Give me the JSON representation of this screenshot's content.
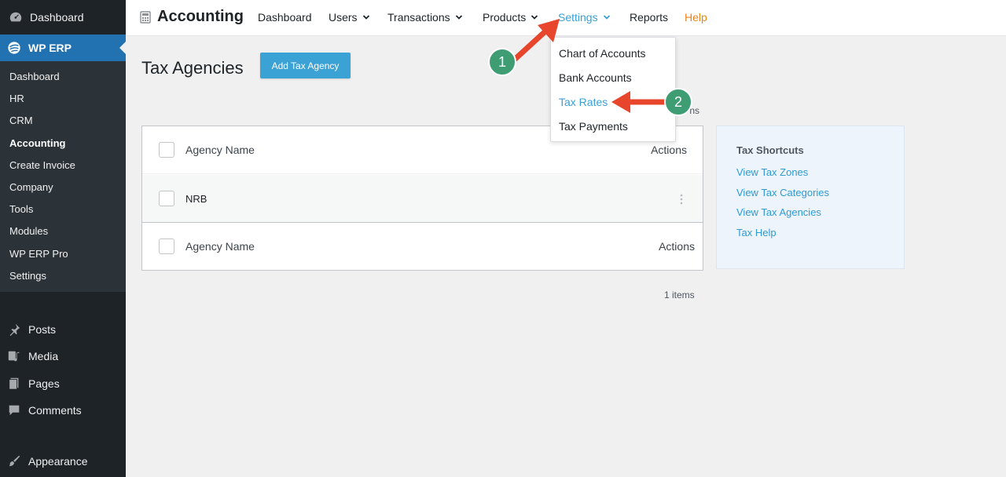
{
  "sidebar": {
    "top_item": "Dashboard",
    "erp_item": "WP ERP",
    "submenu": [
      "Dashboard",
      "HR",
      "CRM",
      "Accounting",
      "Create Invoice",
      "Company",
      "Tools",
      "Modules",
      "WP ERP Pro",
      "Settings"
    ],
    "current_submenu": "Accounting",
    "posts": "Posts",
    "media": "Media",
    "pages": "Pages",
    "comments": "Comments",
    "appearance": "Appearance"
  },
  "topnav": {
    "brand": "Accounting",
    "items": {
      "dashboard": "Dashboard",
      "users": "Users",
      "transactions": "Transactions",
      "products": "Products",
      "settings": "Settings",
      "reports": "Reports",
      "help": "Help"
    }
  },
  "settings_dropdown": {
    "items": [
      "Chart of Accounts",
      "Bank Accounts",
      "Tax Rates",
      "Tax Payments"
    ],
    "active": "Tax Rates"
  },
  "main": {
    "title": "Tax Agencies",
    "add_button": "Add Tax Agency",
    "items_top": "ns",
    "items_bottom": "1 items",
    "table": {
      "col_name": "Agency Name",
      "col_actions": "Actions",
      "rows": [
        {
          "name": "NRB"
        }
      ]
    }
  },
  "shortcuts": {
    "title": "Tax Shortcuts",
    "links": [
      "View Tax Zones",
      "View Tax Categories",
      "View Tax Agencies",
      "Tax Help"
    ]
  },
  "annotations": {
    "step1": "1",
    "step2": "2"
  },
  "colors": {
    "accent": "#3ba2d6",
    "help": "#e8861a",
    "sidebar_bg": "#1d2327",
    "wp_blue": "#2271b1",
    "badge": "#3f9d73",
    "arrow": "#e8452d"
  }
}
